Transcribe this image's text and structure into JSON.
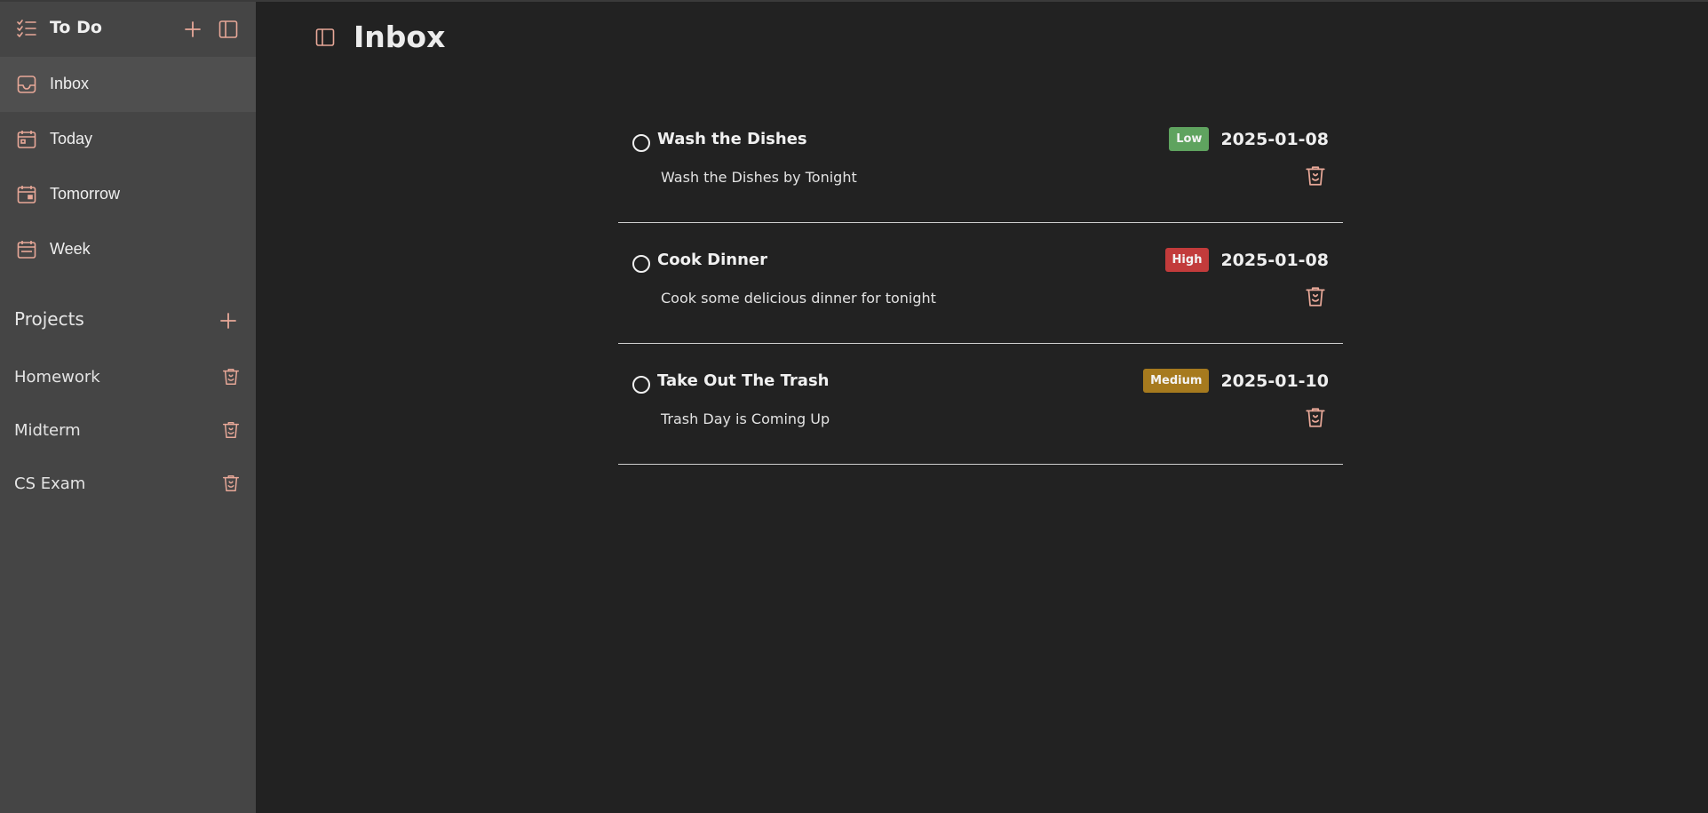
{
  "sidebar": {
    "app_title": "To Do",
    "nav": [
      {
        "label": "Inbox",
        "icon": "inbox-icon",
        "active": true
      },
      {
        "label": "Today",
        "icon": "calendar-today-icon",
        "active": false
      },
      {
        "label": "Tomorrow",
        "icon": "calendar-tomorrow-icon",
        "active": false
      },
      {
        "label": "Week",
        "icon": "calendar-week-icon",
        "active": false
      }
    ],
    "projects_title": "Projects",
    "projects": [
      {
        "label": "Homework"
      },
      {
        "label": "Midterm"
      },
      {
        "label": "CS Exam"
      }
    ]
  },
  "main": {
    "title": "Inbox",
    "tasks": [
      {
        "title": "Wash the Dishes",
        "description": "Wash the Dishes by Tonight",
        "priority": "Low",
        "priority_color": "#5fa35f",
        "due": "2025-01-08"
      },
      {
        "title": "Cook Dinner",
        "description": "Cook some delicious dinner for tonight",
        "priority": "High",
        "priority_color": "#c23b3b",
        "due": "2025-01-08"
      },
      {
        "title": "Take Out The Trash",
        "description": "Trash Day is Coming Up",
        "priority": "Medium",
        "priority_color": "#a67a1e",
        "due": "2025-01-10"
      }
    ]
  },
  "colors": {
    "accent": "#e8a898",
    "sidebar_bg": "#454545",
    "main_bg": "#222222"
  }
}
